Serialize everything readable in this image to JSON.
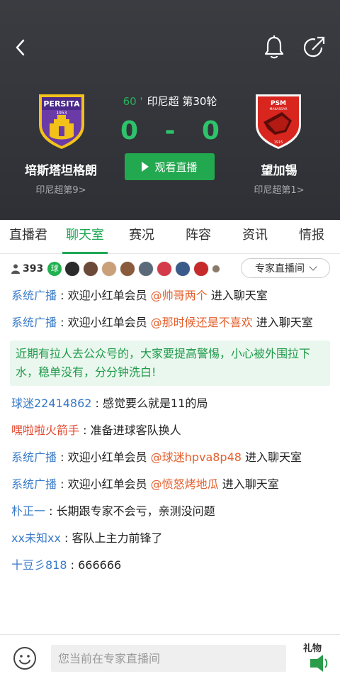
{
  "match": {
    "minute": "60 '",
    "league_round": "印尼超 第30轮",
    "home_score": "0",
    "separator": "-",
    "away_score": "0",
    "watch_label": "观看直播"
  },
  "home_team": {
    "name": "培斯塔坦格朗",
    "rank": "印尼超第9>",
    "logo_text": "PERSITA",
    "logo_year": "1953"
  },
  "away_team": {
    "name": "望加锡",
    "rank": "印尼超第1>",
    "logo_text": "PSM",
    "logo_sub": "MAKASSAR",
    "logo_year": "1915"
  },
  "tabs": [
    {
      "label": "直播君"
    },
    {
      "label": "聊天室"
    },
    {
      "label": "赛况"
    },
    {
      "label": "阵容"
    },
    {
      "label": "资讯"
    },
    {
      "label": "情报"
    }
  ],
  "online": {
    "count": "393",
    "ball_badge": "球",
    "expert_label": "专家直播间"
  },
  "messages": [
    {
      "sender": "系统广播",
      "sep": " : ",
      "pre": "欢迎小红单会员 ",
      "mention": "@帅哥两个",
      "post": " 进入聊天室"
    },
    {
      "sender": "系统广播",
      "sep": " : ",
      "pre": "欢迎小红单会员 ",
      "mention": "@那时候还是不喜欢",
      "post": " 进入聊天室"
    },
    {
      "sender": "球迷22414862",
      "sep": " : ",
      "text": "感觉要么就是11的局"
    },
    {
      "sender": "嘿啦啦火箭手",
      "sep": " : ",
      "text": "准备进球客队换人"
    },
    {
      "sender": "系统广播",
      "sep": " : ",
      "pre": "欢迎小红单会员 ",
      "mention": "@球迷hpva8p48",
      "post": " 进入聊天室"
    },
    {
      "sender": "系统广播",
      "sep": " : ",
      "pre": "欢迎小红单会员 ",
      "mention": "@愤怒烤地瓜",
      "post": " 进入聊天室"
    },
    {
      "sender": "朴正一",
      "sep": " : ",
      "text": "长期跟专家不会亏，亲测没问题"
    },
    {
      "sender": "xx未知xx",
      "sep": " : ",
      "text": "客队上主力前锋了"
    },
    {
      "sender": "十豆彡818",
      "sep": " : ",
      "text": "666666"
    }
  ],
  "notice": "近期有拉人去公众号的，大家要提高警惕，小心被外围拉下水，稳单没有，分分钟洗白!",
  "input": {
    "placeholder": "您当前在专家直播间"
  },
  "gift": {
    "label": "礼物"
  },
  "colors": {
    "accent": "#1ea752",
    "header_bg": "#33353a",
    "link_blue": "#3a7bc8",
    "mention_orange": "#e4602e"
  }
}
